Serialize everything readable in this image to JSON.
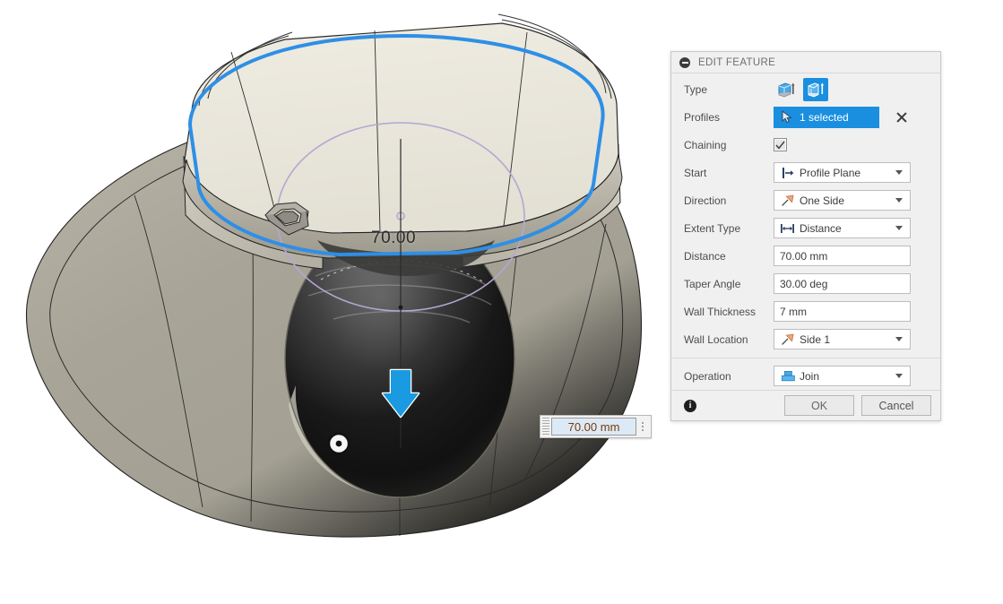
{
  "viewport": {
    "name": "3d-viewport",
    "dimension_label": "70.00",
    "float_input": {
      "value": "70.00 mm",
      "menu_icon": "kebab-menu-icon",
      "grip_icon": "drag-grip-icon"
    },
    "manipulator": {
      "arrow_icon": "direction-arrow-down-icon",
      "handle_icon": "drag-handle-dot-icon"
    },
    "colors": {
      "selection_blue": "#1a8fe0",
      "profile_outline": "#2e8fe6",
      "sketch_purple": "#b3a6d4",
      "body_light": "#ece9de",
      "body_mid": "#a9a699",
      "body_dark": "#8f8c80",
      "cavity_dark": "#1b1b1b"
    }
  },
  "dialog": {
    "title": "EDIT FEATURE",
    "collapse_icon": "collapse-minus-icon",
    "rows": {
      "type": {
        "label": "Type",
        "options": [
          {
            "icon": "extrude-solid-icon",
            "selected": false
          },
          {
            "icon": "extrude-thin-icon",
            "selected": true
          }
        ]
      },
      "profiles": {
        "label": "Profiles",
        "value": "1 selected",
        "cursor_icon": "select-cursor-icon",
        "clear_icon": "clear-x-icon"
      },
      "chaining": {
        "label": "Chaining",
        "checked": true,
        "check_icon": "checkmark-icon"
      },
      "start": {
        "label": "Start",
        "value": "Profile Plane",
        "icon": "profile-plane-icon",
        "caret_icon": "chevron-down-icon"
      },
      "direction": {
        "label": "Direction",
        "value": "One Side",
        "icon": "one-side-arrow-icon",
        "caret_icon": "chevron-down-icon"
      },
      "extent_type": {
        "label": "Extent Type",
        "value": "Distance",
        "icon": "distance-measure-icon",
        "caret_icon": "chevron-down-icon"
      },
      "distance": {
        "label": "Distance",
        "value": "70.00 mm"
      },
      "taper_angle": {
        "label": "Taper Angle",
        "value": "30.00 deg"
      },
      "wall_thickness": {
        "label": "Wall Thickness",
        "value": "7 mm"
      },
      "wall_location": {
        "label": "Wall Location",
        "value": "Side 1",
        "icon": "side-one-arrow-icon",
        "caret_icon": "chevron-down-icon"
      },
      "operation": {
        "label": "Operation",
        "value": "Join",
        "icon": "join-operation-icon",
        "caret_icon": "chevron-down-icon"
      }
    },
    "footer": {
      "info_icon": "info-icon",
      "ok_label": "OK",
      "cancel_label": "Cancel"
    }
  }
}
